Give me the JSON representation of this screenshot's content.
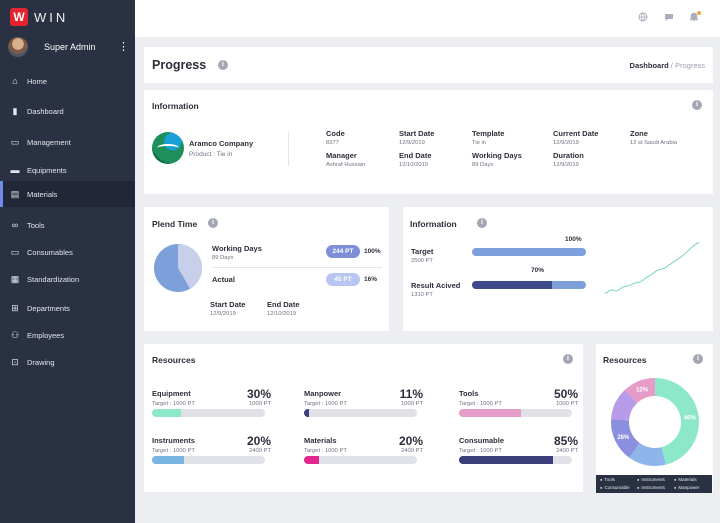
{
  "app": {
    "logo_letter": "W",
    "logo_text": "WIN"
  },
  "user": {
    "name": "Super Admin",
    "menu": "⋮"
  },
  "sidebar": {
    "items": [
      {
        "label": "Home",
        "icon": "home-icon",
        "glyph": "⌂"
      },
      {
        "label": "Dashboard",
        "icon": "bar-chart-icon",
        "glyph": "▮"
      },
      {
        "label": "Management",
        "icon": "id-card-icon",
        "glyph": "▭"
      },
      {
        "label": "Equipments",
        "icon": "truck-icon",
        "glyph": "▬"
      },
      {
        "label": "Materials",
        "icon": "document-icon",
        "glyph": "▤"
      },
      {
        "label": "Tools",
        "icon": "infinity-icon",
        "glyph": "∞"
      },
      {
        "label": "Consumables",
        "icon": "message-icon",
        "glyph": "▭"
      },
      {
        "label": "Standardization",
        "icon": "grid-icon",
        "glyph": "▦"
      },
      {
        "label": "Departments",
        "icon": "plus-box-icon",
        "glyph": "⊞"
      },
      {
        "label": "Employees",
        "icon": "people-icon",
        "glyph": "⚇"
      },
      {
        "label": "Drawing",
        "icon": "resize-icon",
        "glyph": "⊡"
      }
    ],
    "active": "Materials"
  },
  "topbar": {
    "icons": [
      "globe-icon",
      "chat-icon",
      "bell-icon"
    ]
  },
  "progress": {
    "title": "Progress",
    "breadcrumb_root": "Dashboard",
    "breadcrumb_sep": " / ",
    "breadcrumb_current": "Progress"
  },
  "information": {
    "title": "Information",
    "company": "Aramco Company",
    "product": "Product : Tie in",
    "fields": [
      {
        "label": "Code",
        "value": "8377"
      },
      {
        "label": "Start Date",
        "value": "12/9/2019"
      },
      {
        "label": "Template",
        "value": "Tie in"
      },
      {
        "label": "Current Date",
        "value": "12/9/2019"
      },
      {
        "label": "Zone",
        "value": "12 st Saudi Arabia"
      },
      {
        "label": "Manager",
        "value": "Ashraf Hussain"
      },
      {
        "label": "End Date",
        "value": "12/10/2019"
      },
      {
        "label": "Working Days",
        "value": "89 Days"
      },
      {
        "label": "Duration",
        "value": "12/9/2019"
      }
    ]
  },
  "plend": {
    "title": "Plend Time",
    "working_days_label": "Working Days",
    "working_days_sub": "89 Days",
    "working_pill": "244 PT",
    "working_pct": "100%",
    "actual_label": "Actual",
    "actual_pill": "45 PT",
    "actual_pct": "16%",
    "start_label": "Start Date",
    "start_value": "12/9/2019",
    "end_label": "End Date",
    "end_value": "12/10/2019",
    "pie_actual_fraction": 0.16,
    "colors": {
      "main": "#7d9fda",
      "light": "#c7cfeb",
      "pill_main": "#7d8fd6",
      "pill_light": "#b9c6ef"
    }
  },
  "info2": {
    "title": "Information",
    "target_label": "Target",
    "target_sub": "2500 PT",
    "target_pct": "100%",
    "target_value": 1.0,
    "result_label": "Result Acived",
    "result_sub": "1310 PT",
    "result_pct": "70%",
    "result_value": 0.7,
    "sparkline": [
      0.08,
      0.14,
      0.12,
      0.18,
      0.2,
      0.24,
      0.26,
      0.32,
      0.38,
      0.44,
      0.46,
      0.52,
      0.58,
      0.64,
      0.72,
      0.8,
      0.86
    ]
  },
  "resources": {
    "title": "Resources",
    "items": [
      {
        "name": "Equipment",
        "target": "Target : 1000 PT",
        "pct": "30%",
        "pts": "1000 PT",
        "value": 0.26,
        "color": "#8de8c9"
      },
      {
        "name": "Manpower",
        "target": "Target : 1000 PT",
        "pct": "11%",
        "pts": "1000 PT",
        "value": 0.04,
        "color": "#3a3f7a"
      },
      {
        "name": "Tools",
        "target": "Target : 1000 PT",
        "pct": "50%",
        "pts": "1000 PT",
        "value": 0.55,
        "color": "#e59cc8"
      },
      {
        "name": "Instruments",
        "target": "Target : 1000 PT",
        "pct": "20%",
        "pts": "2400 PT",
        "value": 0.28,
        "color": "#7ab4e0"
      },
      {
        "name": "Materials",
        "target": "Target : 1000 PT",
        "pct": "20%",
        "pts": "2400 PT",
        "value": 0.13,
        "color": "#e0278f"
      },
      {
        "name": "Consumable",
        "target": "Target : 1000 PT",
        "pct": "85%",
        "pts": "2400 PT",
        "value": 0.83,
        "color": "#3a3f7a"
      }
    ]
  },
  "resources_donut": {
    "title": "Resources",
    "slices": [
      {
        "label": "46%",
        "value": 46,
        "color": "#8de8c9"
      },
      {
        "label": "",
        "value": 14,
        "color": "#8fb6ea"
      },
      {
        "label": "28%",
        "value": 16,
        "color": "#8a8fe0"
      },
      {
        "label": "",
        "value": 12,
        "color": "#b79ae8"
      },
      {
        "label": "12%",
        "value": 12,
        "color": "#e59cc8"
      }
    ],
    "legend": [
      "Tools",
      "Instruments",
      "Materials",
      "Consumable",
      "Instruments",
      "Manpower"
    ]
  }
}
